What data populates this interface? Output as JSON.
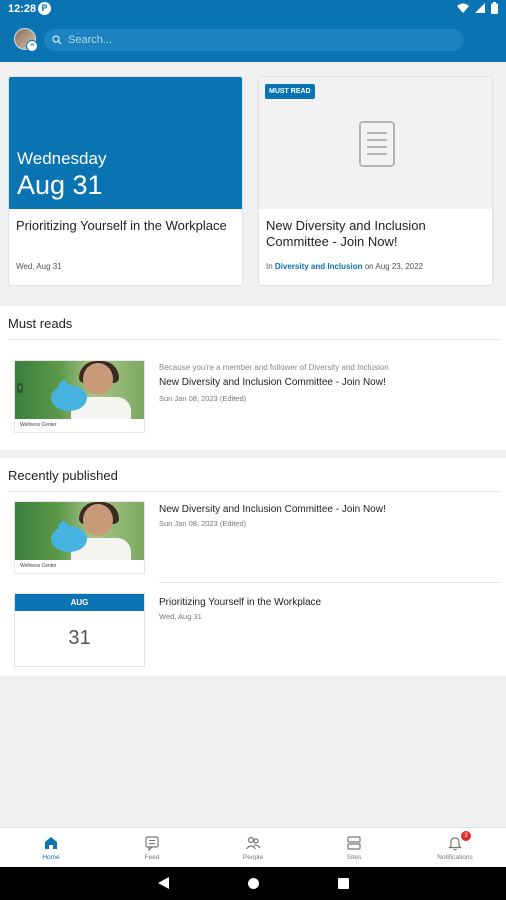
{
  "status_bar": {
    "time": "12:28",
    "app_letter": "P"
  },
  "search": {
    "placeholder": "Search..."
  },
  "cards": [
    {
      "day_name": "Wednesday",
      "date": "Aug 31",
      "title": "Prioritizing Yourself in the Workplace",
      "meta": "Wed, Aug 31"
    },
    {
      "badge": "MUST READ",
      "title": "New Diversity and Inclusion Committee - Join Now!",
      "meta_prefix": "In",
      "meta_link": "Diversity and Inclusion",
      "meta_suffix": "on Aug 23, 2022"
    }
  ],
  "must_reads": {
    "title": "Must reads",
    "items": [
      {
        "context": "Because you're a member and follower of Diversity and Inclusion",
        "title": "New Diversity and Inclusion Committee - Join Now!",
        "date": "Sun Jan 08, 2023 (Edited)",
        "thumb_caption": "Wellness Center"
      }
    ]
  },
  "recently_published": {
    "title": "Recently published",
    "items": [
      {
        "title": "New Diversity and Inclusion Committee - Join Now!",
        "date": "Sun Jan 08, 2023 (Edited)",
        "thumb_caption": "Wellness Center"
      },
      {
        "title": "Prioritizing Yourself in the Workplace",
        "date": "Wed, Aug 31",
        "tile_month": "AUG",
        "tile_day": "31"
      }
    ]
  },
  "bottom_nav": {
    "items": [
      {
        "label": "Home",
        "active": true
      },
      {
        "label": "Feed"
      },
      {
        "label": "People"
      },
      {
        "label": "Sites"
      },
      {
        "label": "Notifications",
        "badge": "3"
      }
    ]
  },
  "colors": {
    "brand": "#0a74b3",
    "notification": "#e32b2b"
  }
}
